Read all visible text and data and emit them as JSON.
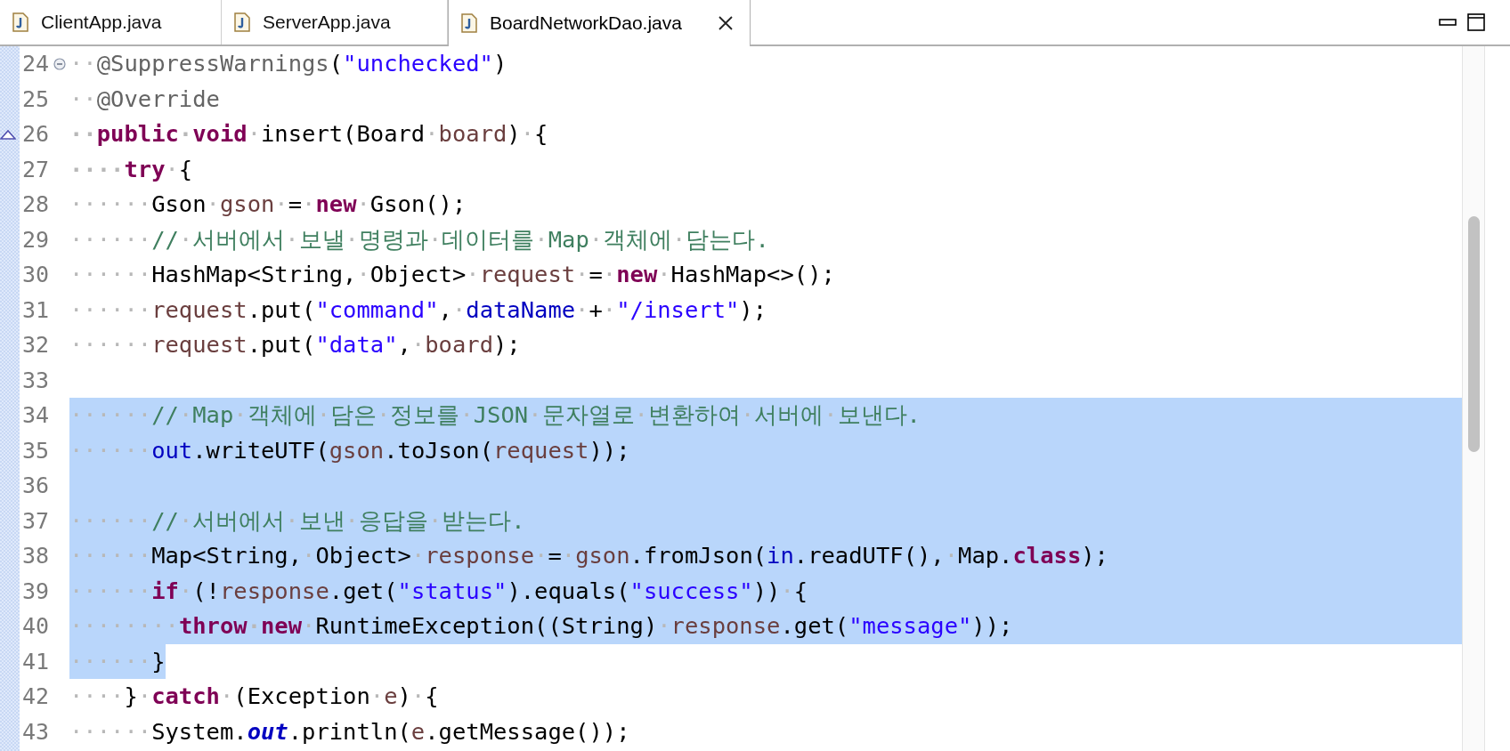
{
  "tabs": [
    {
      "label": "ClientApp.java",
      "selected": false,
      "closable": false
    },
    {
      "label": "ServerApp.java",
      "selected": false,
      "closable": false
    },
    {
      "label": "BoardNetworkDao.java",
      "selected": true,
      "closable": true
    }
  ],
  "editor": {
    "lines": [
      {
        "number": "24",
        "collapsible": true,
        "overrides": false,
        "selected": false,
        "tokens": [
          {
            "kind": "plain",
            "text": "··"
          },
          {
            "kind": "annotation",
            "text": "@SuppressWarnings"
          },
          {
            "kind": "plain",
            "text": "("
          },
          {
            "kind": "string",
            "text": "\"unchecked\""
          },
          {
            "kind": "plain",
            "text": ")"
          }
        ]
      },
      {
        "number": "25",
        "collapsible": false,
        "overrides": false,
        "selected": false,
        "tokens": [
          {
            "kind": "plain",
            "text": "··"
          },
          {
            "kind": "annotation",
            "text": "@Override"
          }
        ]
      },
      {
        "number": "26",
        "collapsible": false,
        "overrides": true,
        "selected": false,
        "tokens": [
          {
            "kind": "keyword",
            "text": "··public·void"
          },
          {
            "kind": "plain",
            "text": "·insert(Board·"
          },
          {
            "kind": "variable",
            "text": "board"
          },
          {
            "kind": "plain",
            "text": ")·{"
          }
        ]
      },
      {
        "number": "27",
        "collapsible": false,
        "overrides": false,
        "selected": false,
        "tokens": [
          {
            "kind": "keyword",
            "text": "····try"
          },
          {
            "kind": "plain",
            "text": "·{"
          }
        ]
      },
      {
        "number": "28",
        "collapsible": false,
        "overrides": false,
        "selected": false,
        "tokens": [
          {
            "kind": "plain",
            "text": "······Gson·"
          },
          {
            "kind": "variable",
            "text": "gson"
          },
          {
            "kind": "plain",
            "text": "·=·"
          },
          {
            "kind": "keyword",
            "text": "new"
          },
          {
            "kind": "plain",
            "text": "·Gson();"
          }
        ]
      },
      {
        "number": "29",
        "collapsible": false,
        "overrides": false,
        "selected": false,
        "tokens": [
          {
            "kind": "plain",
            "text": "······"
          },
          {
            "kind": "comment",
            "text": "//·서버에서·보낼·명령과·데이터를·Map·객체에·담는다."
          }
        ]
      },
      {
        "number": "30",
        "collapsible": false,
        "overrides": false,
        "selected": false,
        "tokens": [
          {
            "kind": "plain",
            "text": "······HashMap<String,·Object>·"
          },
          {
            "kind": "variable",
            "text": "request"
          },
          {
            "kind": "plain",
            "text": "·=·"
          },
          {
            "kind": "keyword",
            "text": "new"
          },
          {
            "kind": "plain",
            "text": "·HashMap<>();"
          }
        ]
      },
      {
        "number": "31",
        "collapsible": false,
        "overrides": false,
        "selected": false,
        "tokens": [
          {
            "kind": "plain",
            "text": "······"
          },
          {
            "kind": "variable",
            "text": "request"
          },
          {
            "kind": "plain",
            "text": ".put("
          },
          {
            "kind": "string",
            "text": "\"command\""
          },
          {
            "kind": "plain",
            "text": ",·"
          },
          {
            "kind": "field",
            "text": "dataName"
          },
          {
            "kind": "plain",
            "text": "·+·"
          },
          {
            "kind": "string",
            "text": "\"/insert\""
          },
          {
            "kind": "plain",
            "text": ");"
          }
        ]
      },
      {
        "number": "32",
        "collapsible": false,
        "overrides": false,
        "selected": false,
        "tokens": [
          {
            "kind": "plain",
            "text": "······"
          },
          {
            "kind": "variable",
            "text": "request"
          },
          {
            "kind": "plain",
            "text": ".put("
          },
          {
            "kind": "string",
            "text": "\"data\""
          },
          {
            "kind": "plain",
            "text": ",·"
          },
          {
            "kind": "variable",
            "text": "board"
          },
          {
            "kind": "plain",
            "text": ");"
          }
        ]
      },
      {
        "number": "33",
        "collapsible": false,
        "overrides": false,
        "selected": false
      },
      {
        "number": "34",
        "collapsible": false,
        "overrides": false,
        "selected": true,
        "line_end_selected": true,
        "tokens": [
          {
            "kind": "plain",
            "text": "······"
          },
          {
            "kind": "comment",
            "text": "//·Map·객체에·담은·정보를·JSON·문자열로·변환하여·서버에·보낸다."
          }
        ]
      },
      {
        "number": "35",
        "collapsible": false,
        "overrides": false,
        "selected": true,
        "line_end_selected": true,
        "tokens": [
          {
            "kind": "plain",
            "text": "······"
          },
          {
            "kind": "field",
            "text": "out"
          },
          {
            "kind": "plain",
            "text": ".writeUTF("
          },
          {
            "kind": "variable",
            "text": "gson"
          },
          {
            "kind": "plain",
            "text": ".toJson("
          },
          {
            "kind": "variable",
            "text": "request"
          },
          {
            "kind": "plain",
            "text": "));"
          }
        ]
      },
      {
        "number": "36",
        "collapsible": false,
        "overrides": false,
        "selected": true,
        "line_end_selected": true
      },
      {
        "number": "37",
        "collapsible": false,
        "overrides": false,
        "selected": true,
        "line_end_selected": true,
        "tokens": [
          {
            "kind": "plain",
            "text": "······"
          },
          {
            "kind": "comment",
            "text": "//·서버에서·보낸·응답을·받는다."
          }
        ]
      },
      {
        "number": "38",
        "collapsible": false,
        "overrides": false,
        "selected": true,
        "line_end_selected": true,
        "tokens": [
          {
            "kind": "plain",
            "text": "······Map<String,·Object>·"
          },
          {
            "kind": "variable",
            "text": "response"
          },
          {
            "kind": "plain",
            "text": "·=·"
          },
          {
            "kind": "variable",
            "text": "gson"
          },
          {
            "kind": "plain",
            "text": ".fromJson("
          },
          {
            "kind": "field",
            "text": "in"
          },
          {
            "kind": "plain",
            "text": ".readUTF(),·Map."
          },
          {
            "kind": "keyword",
            "text": "class"
          },
          {
            "kind": "plain",
            "text": ");"
          }
        ]
      },
      {
        "number": "39",
        "collapsible": false,
        "overrides": false,
        "selected": true,
        "line_end_selected": true,
        "tokens": [
          {
            "kind": "plain",
            "text": "······"
          },
          {
            "kind": "keyword",
            "text": "if"
          },
          {
            "kind": "plain",
            "text": "·(!"
          },
          {
            "kind": "variable",
            "text": "response"
          },
          {
            "kind": "plain",
            "text": ".get("
          },
          {
            "kind": "string",
            "text": "\"status\""
          },
          {
            "kind": "plain",
            "text": ").equals("
          },
          {
            "kind": "string",
            "text": "\"success\""
          },
          {
            "kind": "plain",
            "text": "))·{"
          }
        ]
      },
      {
        "number": "40",
        "collapsible": false,
        "overrides": false,
        "selected": true,
        "line_end_selected": true,
        "tokens": [
          {
            "kind": "plain",
            "text": "········"
          },
          {
            "kind": "keyword",
            "text": "throw·new"
          },
          {
            "kind": "plain",
            "text": "·RuntimeException((String)·"
          },
          {
            "kind": "variable",
            "text": "response"
          },
          {
            "kind": "plain",
            "text": ".get("
          },
          {
            "kind": "string",
            "text": "\"message\""
          },
          {
            "kind": "plain",
            "text": "));"
          }
        ]
      },
      {
        "number": "41",
        "collapsible": false,
        "overrides": false,
        "selected": true,
        "line_end_selected": false,
        "tokens": [
          {
            "kind": "plain",
            "text": "······}"
          }
        ]
      },
      {
        "number": "42",
        "collapsible": false,
        "overrides": false,
        "selected": false,
        "tokens": [
          {
            "kind": "plain",
            "text": "····}·"
          },
          {
            "kind": "keyword",
            "text": "catch"
          },
          {
            "kind": "plain",
            "text": "·(Exception·"
          },
          {
            "kind": "variable",
            "text": "e"
          },
          {
            "kind": "plain",
            "text": ")·{"
          }
        ]
      },
      {
        "number": "43",
        "collapsible": false,
        "overrides": false,
        "selected": false,
        "tokens": [
          {
            "kind": "plain",
            "text": "······System."
          },
          {
            "kind": "static_field",
            "text": "out"
          },
          {
            "kind": "plain",
            "text": ".println("
          },
          {
            "kind": "variable",
            "text": "e"
          },
          {
            "kind": "plain",
            "text": ".getMessage());"
          }
        ]
      }
    ]
  }
}
